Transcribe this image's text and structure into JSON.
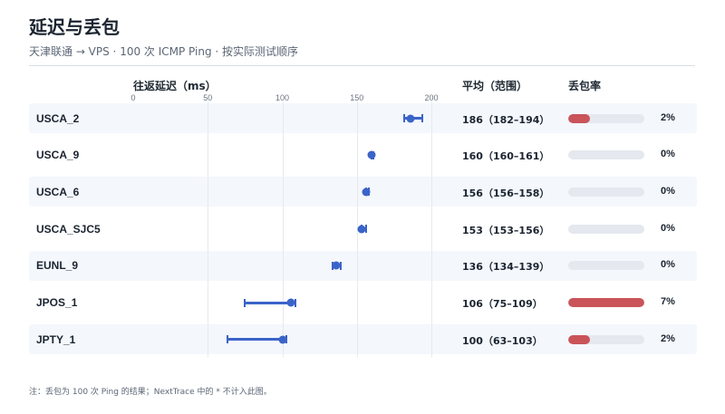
{
  "header": {
    "title": "延迟与丢包",
    "subtitle": "天津联通 → VPS · 100 次 ICMP Ping · 按实际测试顺序"
  },
  "columns": {
    "latency": "往返延迟（ms）",
    "avg": "平均（范围）",
    "loss": "丢包率"
  },
  "footnote": "注：丢包为 100 次 Ping 的结果；NextTrace 中的 * 不计入此图。",
  "colors": {
    "accent": "#3a64c8",
    "loss": "#c9545a",
    "track": "#e5e8ee",
    "row_alt": "#f4f7fc"
  },
  "chart_data": {
    "type": "scatter",
    "xlabel": "往返延迟（ms）",
    "xlim": [
      0,
      200
    ],
    "xticks": [
      "0",
      "50",
      "100",
      "150",
      "200"
    ],
    "rows": [
      {
        "name": "USCA_2",
        "avg": 186,
        "min": 182,
        "max": 194,
        "avg_text": "186（182–194）",
        "loss": 2,
        "loss_text": "2%"
      },
      {
        "name": "USCA_9",
        "avg": 160,
        "min": 160,
        "max": 161,
        "avg_text": "160（160–161）",
        "loss": 0,
        "loss_text": "0%"
      },
      {
        "name": "USCA_6",
        "avg": 156,
        "min": 156,
        "max": 158,
        "avg_text": "156（156–158）",
        "loss": 0,
        "loss_text": "0%"
      },
      {
        "name": "USCA_SJC5",
        "avg": 153,
        "min": 153,
        "max": 156,
        "avg_text": "153（153–156）",
        "loss": 0,
        "loss_text": "0%"
      },
      {
        "name": "EUNL_9",
        "avg": 136,
        "min": 134,
        "max": 139,
        "avg_text": "136（134–139）",
        "loss": 0,
        "loss_text": "0%"
      },
      {
        "name": "JPOS_1",
        "avg": 106,
        "min": 75,
        "max": 109,
        "avg_text": "106（75–109）",
        "loss": 7,
        "loss_text": "7%"
      },
      {
        "name": "JPTY_1",
        "avg": 100,
        "min": 63,
        "max": 103,
        "avg_text": "100（63–103）",
        "loss": 2,
        "loss_text": "2%"
      }
    ],
    "loss_max": 7
  }
}
